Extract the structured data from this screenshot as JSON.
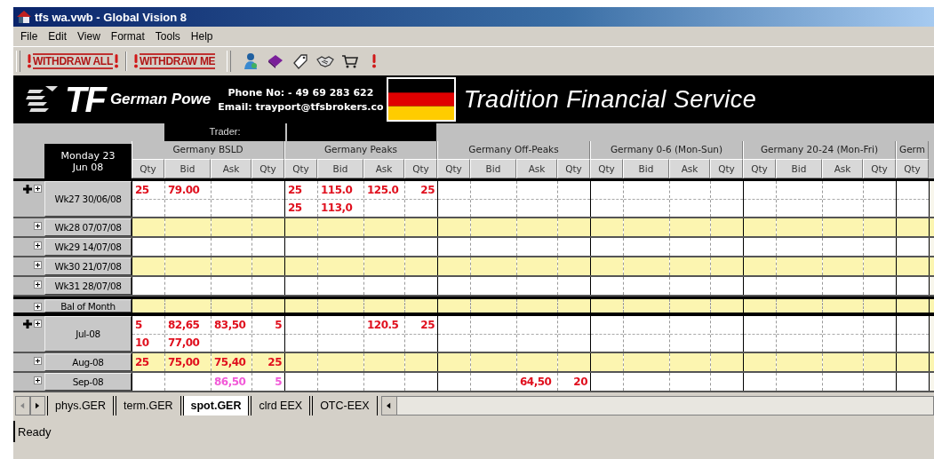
{
  "window": {
    "title": "tfs wa.vwb - Global Vision 8"
  },
  "menu": [
    "File",
    "Edit",
    "View",
    "Format",
    "Tools",
    "Help"
  ],
  "toolbar": {
    "buttons": [
      "WITHDRAW ALL",
      "WITHDRAW ME"
    ]
  },
  "banner": {
    "logo": "TF",
    "market": "German Powe",
    "phone": "Phone No: - 49 69 283 622",
    "email": "Email: trayport@tfsbrokers.co",
    "company": "Tradition Financial Service"
  },
  "trader": {
    "label": "Trader:"
  },
  "date": [
    "Monday 23",
    "Jun 08"
  ],
  "groups": [
    {
      "name": "Germany BSLD",
      "columns": [
        "Qty",
        "Bid",
        "Ask",
        "Qty"
      ]
    },
    {
      "name": "Germany Peaks",
      "columns": [
        "Qty",
        "Bid",
        "Ask",
        "Qty"
      ]
    },
    {
      "name": "Germany Off-Peaks",
      "columns": [
        "Qty",
        "Bid",
        "Ask",
        "Qty"
      ]
    },
    {
      "name": "Germany 0-6 (Mon-Sun)",
      "columns": [
        "Qty",
        "Bid",
        "Ask",
        "Qty"
      ]
    },
    {
      "name": "Germany 20-24 (Mon-Fri)",
      "columns": [
        "Qty",
        "Bid",
        "Ask",
        "Qty"
      ]
    },
    {
      "name": "Germ",
      "columns": [
        "Qty"
      ]
    }
  ],
  "rows": [
    {
      "label": "Wk27 30/06/08",
      "marked": true,
      "shaded": false,
      "thick_border": false,
      "bsld": [
        {
          "bid_qty": "25",
          "bid": "79.00",
          "color": "#e0101e"
        }
      ],
      "peaks": [
        {
          "bid_qty": "25",
          "bid": "115.0",
          "ask": "125.0",
          "ask_qty": "25",
          "color": "#e0101e"
        },
        {
          "bid_qty": "25",
          "bid": "113,0",
          "color": "#e0101e"
        }
      ]
    },
    {
      "label": "Wk28 07/07/08",
      "marked": false,
      "shaded": true,
      "thick_border": false
    },
    {
      "label": "Wk29 14/07/08",
      "marked": false,
      "shaded": false,
      "thick_border": false
    },
    {
      "label": "Wk30 21/07/08",
      "marked": false,
      "shaded": true,
      "thick_border": false
    },
    {
      "label": "Wk31 28/07/08",
      "marked": false,
      "shaded": false,
      "thick_border": false
    },
    {
      "label": "Bal of Month",
      "marked": false,
      "shaded": true,
      "thick_border": true
    },
    {
      "label": "Jul-08",
      "marked": true,
      "shaded": false,
      "thick_border": false,
      "bsld": [
        {
          "bid_qty": "5",
          "bid": "82,65",
          "ask": "83,50",
          "ask_qty": "5",
          "color": "#e0101e"
        },
        {
          "bid_qty": "10",
          "bid": "77,00",
          "color": "#e0101e"
        }
      ],
      "peaks": [
        {
          "ask": "120.5",
          "ask_qty": "25",
          "color": "#e0101e"
        }
      ]
    },
    {
      "label": "Aug-08",
      "marked": false,
      "shaded": true,
      "thick_border": false,
      "bsld": [
        {
          "bid_qty": "25",
          "bid": "75,00",
          "ask": "75,40",
          "ask_qty": "25",
          "color": "#e0101e"
        }
      ]
    },
    {
      "label": "Sep-08",
      "marked": false,
      "shaded": false,
      "thick_border": false,
      "bsld": [
        {
          "ask": "86,50",
          "ask_qty": "5",
          "color": "#f25ad8"
        }
      ],
      "off_peaks": [
        {
          "ask": "64,50",
          "ask_qty": "20",
          "color": "#e0101e"
        }
      ]
    }
  ],
  "sheet_tabs": [
    {
      "label": "phys.GER",
      "selected": false
    },
    {
      "label": "term.GER",
      "selected": false
    },
    {
      "label": "spot.GER",
      "selected": true
    },
    {
      "label": "clrd EEX",
      "selected": false
    },
    {
      "label": "OTC-EEX",
      "selected": false
    }
  ],
  "status_bar": "Ready"
}
